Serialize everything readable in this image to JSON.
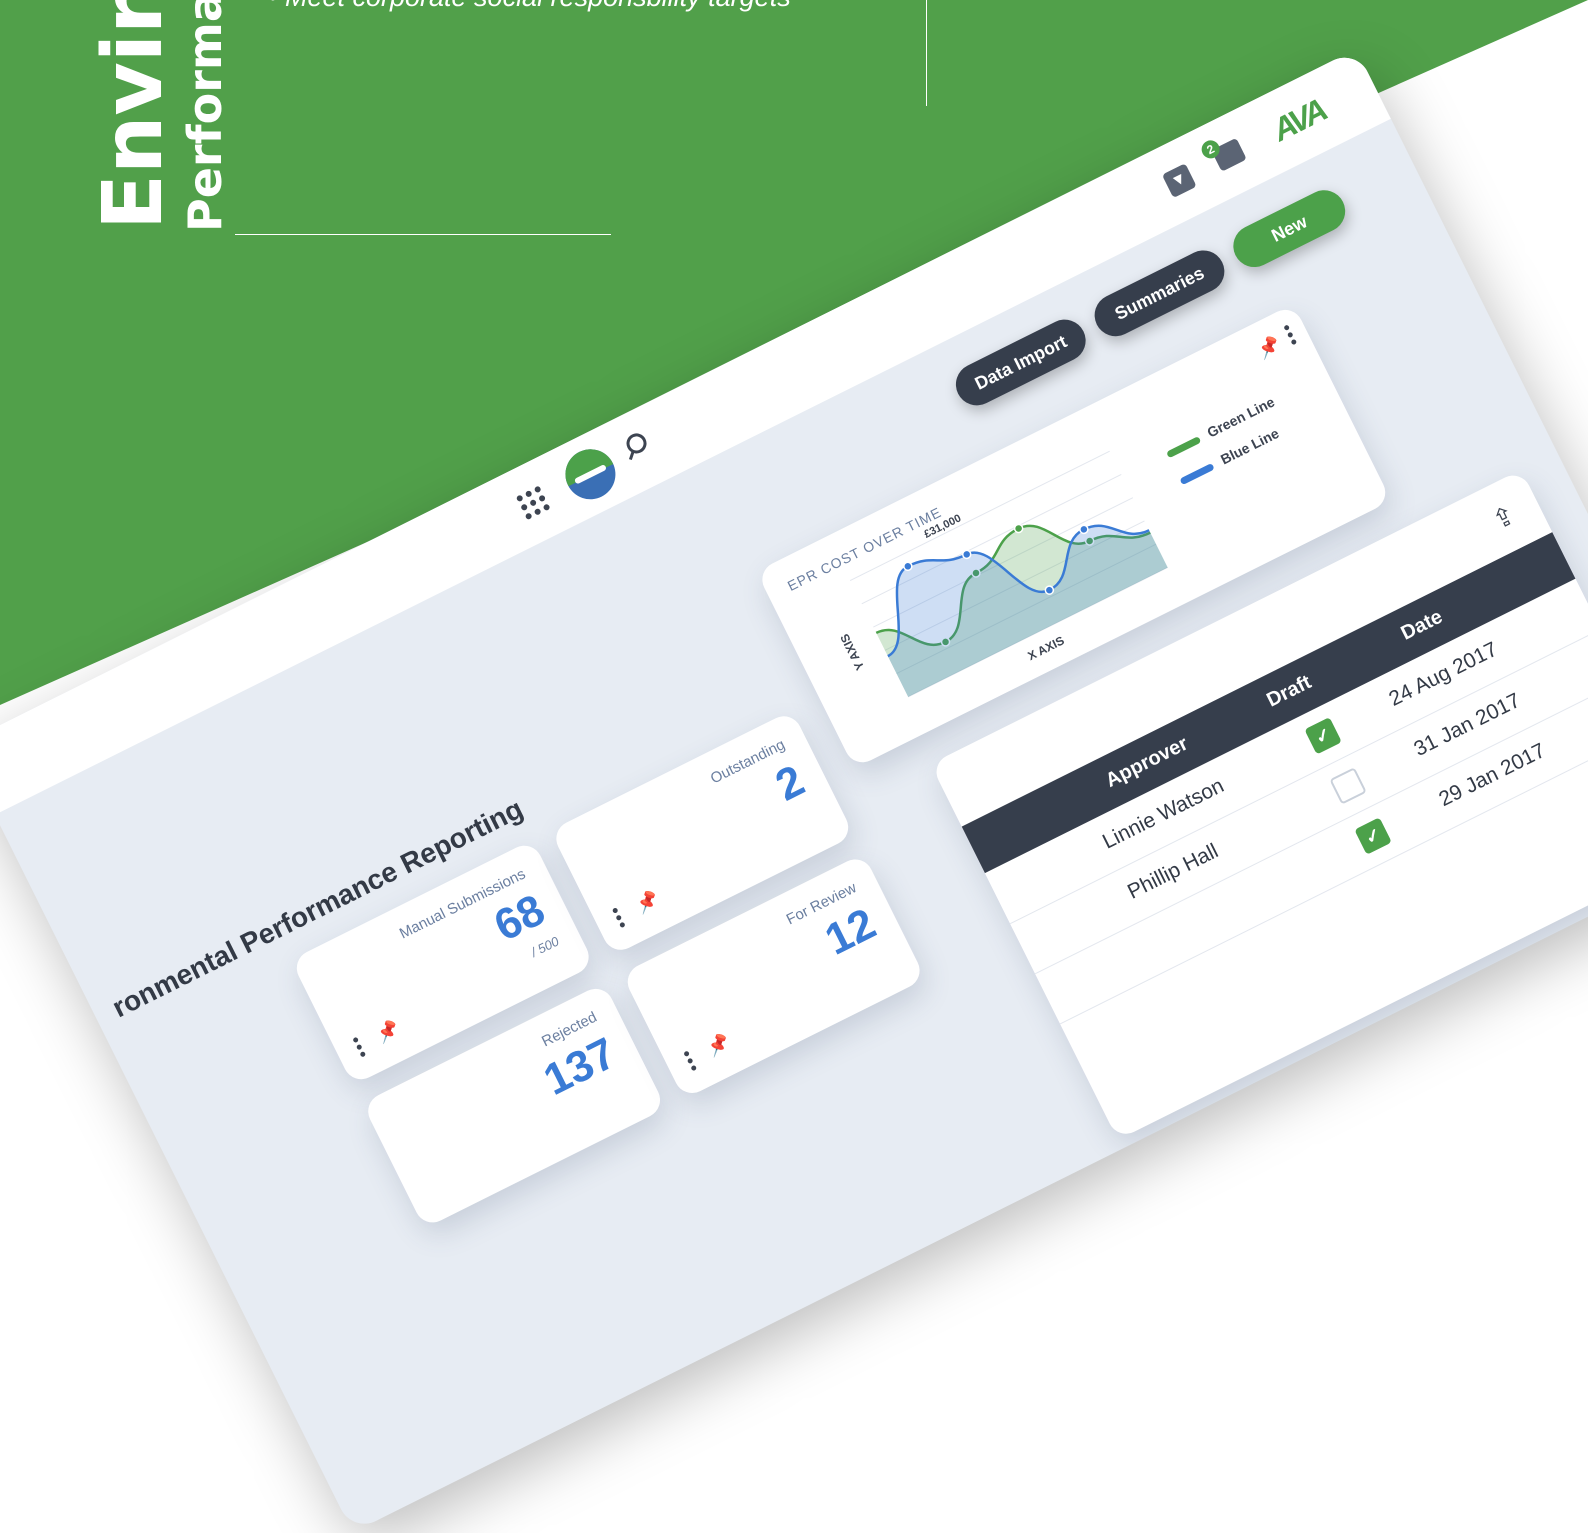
{
  "hero": {
    "title": "Enviro",
    "subtitle": "Performa",
    "bullets": [
      "• Meet corporate social responsbility targets"
    ]
  },
  "topbar": {
    "inbox_badge": "2",
    "brand_logo": "AVA"
  },
  "actions": {
    "data_import": "Data Import",
    "summaries": "Summaries",
    "new": "New"
  },
  "page": {
    "title": "ronmental Performance Reporting"
  },
  "stats": [
    {
      "label": "Manual Submissions",
      "value": "68",
      "sub": "/ 500"
    },
    {
      "label": "Outstanding",
      "value": "2",
      "sub": ""
    },
    {
      "label": "Rejected",
      "value": "137",
      "sub": ""
    },
    {
      "label": "For Review",
      "value": "12",
      "sub": ""
    }
  ],
  "chart_data": {
    "type": "area",
    "title": "EPR COST OVER TIME",
    "xlabel": "X AXIS",
    "ylabel": "Y AXIS",
    "annotation": "£31,000",
    "series": [
      {
        "name": "Green Line",
        "color": "#4ca14a",
        "values": [
          0.55,
          0.25,
          0.62,
          0.78,
          0.45,
          0.3
        ]
      },
      {
        "name": "Blue Line",
        "color": "#3a7bd5",
        "values": [
          0.35,
          0.9,
          0.78,
          0.25,
          0.55,
          0.32
        ]
      }
    ],
    "legend_position": "right"
  },
  "table": {
    "headers": {
      "approver": "Approver",
      "draft": "Draft",
      "date": "Date"
    },
    "rows": [
      {
        "approver": "Linnie Watson",
        "draft": true,
        "date": "24 Aug 2017"
      },
      {
        "approver": "Phillip Hall",
        "draft": false,
        "date": "31 Jan 2017"
      },
      {
        "approver": "",
        "draft": true,
        "date": "29 Jan 2017"
      }
    ]
  },
  "colors": {
    "brand_green": "#51a04a",
    "accent_blue": "#3a7bd5",
    "dark_slate": "#363e4c"
  }
}
